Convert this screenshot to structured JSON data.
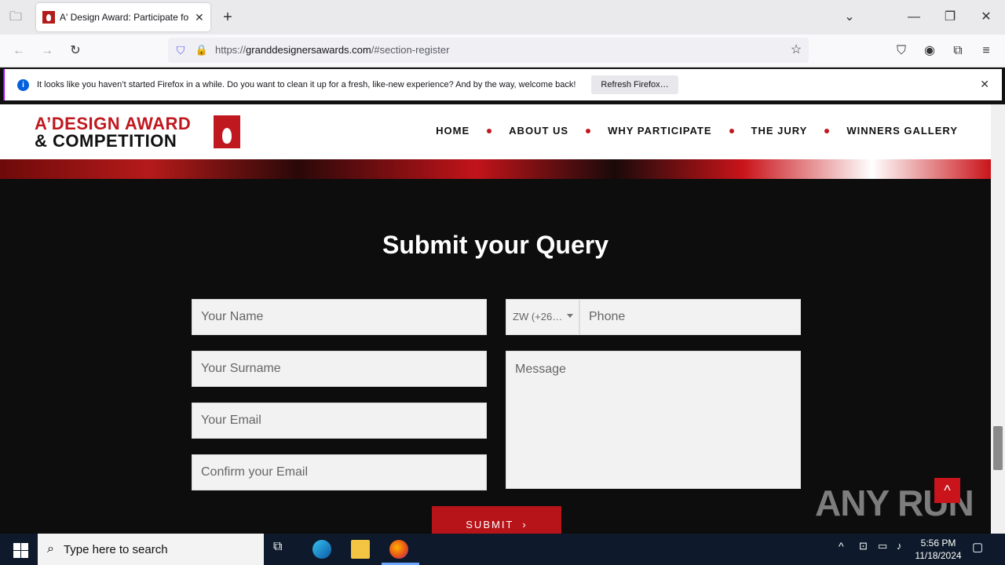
{
  "browser": {
    "tab_title": "A' Design Award: Participate fo",
    "url_prefix": "https://",
    "url_domain": "granddesignersawards.com",
    "url_rest": "/#section-register"
  },
  "notification": {
    "message": "It looks like you haven’t started Firefox in a while. Do you want to clean it up for a fresh, like-new experience? And by the way, welcome back!",
    "button": "Refresh Firefox…"
  },
  "site": {
    "logo_line1": "A’DESIGN AWARD",
    "logo_line2": "& COMPETITION",
    "menu": [
      "HOME",
      "ABOUT US",
      "WHY PARTICIPATE",
      "THE JURY",
      "WINNERS GALLERY"
    ]
  },
  "form": {
    "heading": "Submit your Query",
    "name_placeholder": "Your Name",
    "surname_placeholder": "Your Surname",
    "email_placeholder": "Your Email",
    "confirm_email_placeholder": "Confirm your Email",
    "country_code": "ZW (+26…",
    "phone_placeholder": "Phone",
    "message_placeholder": "Message",
    "submit_label": "SUBMIT"
  },
  "watermark": "ANY RUN",
  "taskbar": {
    "search_placeholder": "Type here to search",
    "time": "5:56 PM",
    "date": "11/18/2024"
  },
  "colors": {
    "brand_red": "#c0181f",
    "page_bg": "#0d0d0d",
    "field_bg": "#f2f2f2"
  }
}
